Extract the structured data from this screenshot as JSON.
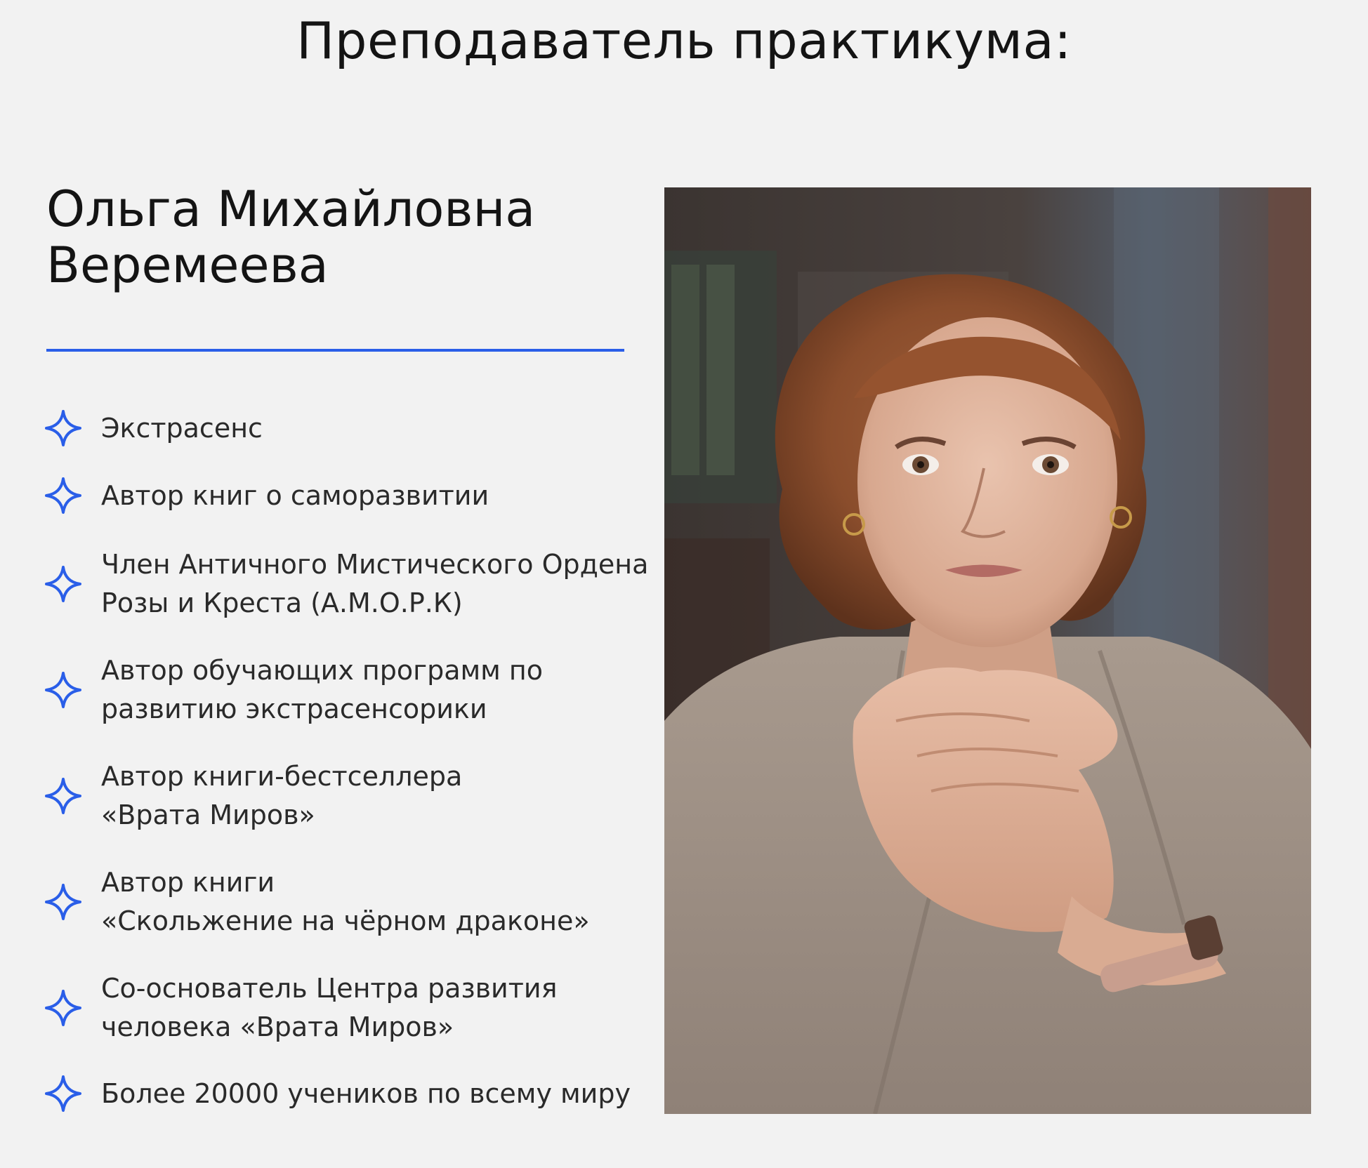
{
  "page": {
    "heading": "Преподаватель практикума:"
  },
  "teacher": {
    "name_line1": "Ольга Михайловна",
    "name_line2": "Веремеева",
    "photo_icon": "portrait-photo",
    "accent_color": "#2a5ee8"
  },
  "credentials": [
    {
      "icon": "sparkle-star-icon",
      "lines": [
        "Экстрасенс"
      ]
    },
    {
      "icon": "sparkle-star-icon",
      "lines": [
        "Автор книг о саморазвитии"
      ]
    },
    {
      "icon": "sparkle-star-icon",
      "lines": [
        "Член Античного Мистического Ордена",
        "Розы и Креста (А.М.О.Р.К)"
      ]
    },
    {
      "icon": "sparkle-star-icon",
      "lines": [
        "Автор обучающих программ по",
        "развитию экстрасенсорики"
      ]
    },
    {
      "icon": "sparkle-star-icon",
      "lines": [
        "Автор книги-бестселлера",
        "«Врата Миров»"
      ]
    },
    {
      "icon": "sparkle-star-icon",
      "lines": [
        "Автор книги",
        "«Скольжение на чёрном драконе»"
      ]
    },
    {
      "icon": "sparkle-star-icon",
      "lines": [
        "Со-основатель Центра развития",
        "человека «Врата Миров»"
      ]
    },
    {
      "icon": "sparkle-star-icon",
      "lines": [
        "Более 20000 учеников по всему миру"
      ]
    }
  ]
}
